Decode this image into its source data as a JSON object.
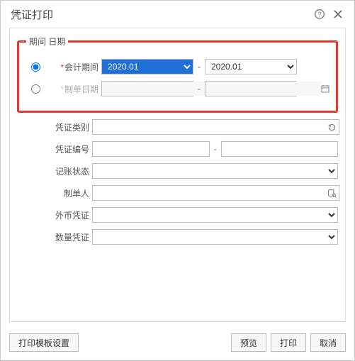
{
  "title": "凭证打印",
  "periodGroup": {
    "legend": "期间 日期",
    "accountPeriod": {
      "label": "会计期间",
      "from": "2020.01",
      "to": "2020.01"
    },
    "makeDate": {
      "label": "制单日期",
      "from": "",
      "to": ""
    },
    "separator": "-"
  },
  "fields": {
    "voucherType": {
      "label": "凭证类别",
      "value": ""
    },
    "voucherNo": {
      "label": "凭证编号",
      "from": "",
      "to": "",
      "sep": "-"
    },
    "postStatus": {
      "label": "记账状态",
      "value": ""
    },
    "maker": {
      "label": "制单人",
      "value": ""
    },
    "foreignCur": {
      "label": "外币凭证",
      "value": ""
    },
    "qtyVoucher": {
      "label": "数量凭证",
      "value": ""
    }
  },
  "buttons": {
    "template": "打印模板设置",
    "preview": "预览",
    "print": "打印",
    "cancel": "取消"
  }
}
